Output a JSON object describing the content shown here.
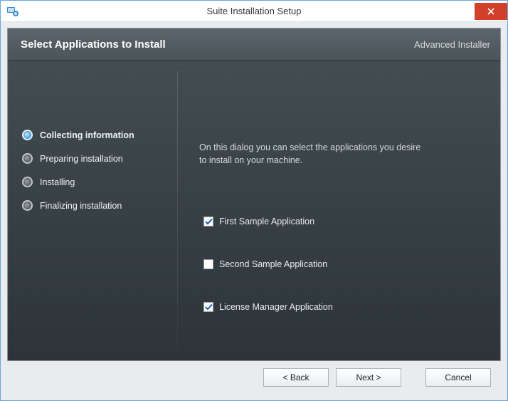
{
  "window": {
    "title": "Suite Installation Setup"
  },
  "header": {
    "page_title": "Select Applications to Install",
    "brand": "Advanced Installer"
  },
  "sidebar": {
    "steps": [
      {
        "label": "Collecting information",
        "active": true
      },
      {
        "label": "Preparing installation",
        "active": false
      },
      {
        "label": "Installing",
        "active": false
      },
      {
        "label": "Finalizing installation",
        "active": false
      }
    ]
  },
  "content": {
    "instructions": "On this dialog you can select the applications you desire to install on your machine.",
    "apps": [
      {
        "label": "First Sample Application",
        "checked": true
      },
      {
        "label": "Second Sample Application",
        "checked": false
      },
      {
        "label": "License Manager Application",
        "checked": true
      }
    ]
  },
  "buttons": {
    "back": "< Back",
    "next": "Next >",
    "cancel": "Cancel"
  }
}
